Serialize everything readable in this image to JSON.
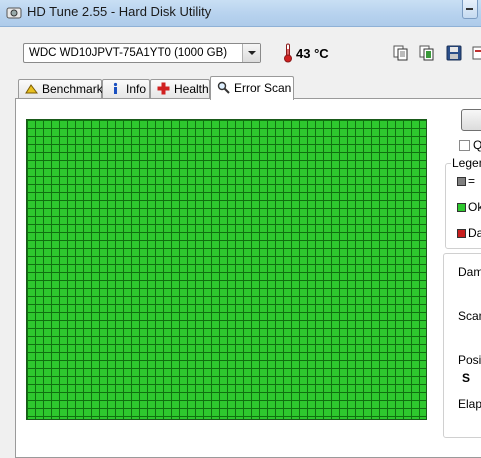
{
  "window": {
    "title": "HD Tune 2.55 - Hard Disk Utility"
  },
  "toolbar": {
    "drive": "WDC WD10JPVT-75A1YT0 (1000 GB)",
    "temperature": "43 °C",
    "icons": [
      "copy-icon",
      "copy-info-icon",
      "save-icon",
      "options-icon"
    ]
  },
  "tabs": [
    {
      "label": "Benchmark",
      "icon": "benchmark-icon"
    },
    {
      "label": "Info",
      "icon": "info-icon"
    },
    {
      "label": "Health",
      "icon": "health-cross-icon"
    },
    {
      "label": "Error Scan",
      "icon": "magnifier-icon",
      "active": true
    }
  ],
  "scan": {
    "block_status": "all ok",
    "colors": {
      "ok": "#2ec82e",
      "grid": "#107010"
    }
  },
  "side": {
    "quick_label": "Q",
    "legend": {
      "title": "Legen",
      "items": [
        {
          "label": "= ",
          "color": "#808080"
        },
        {
          "label": "Ok",
          "color": "#2ec82e"
        },
        {
          "label": "Da",
          "color": "#c81e1e"
        }
      ]
    },
    "stats": {
      "damaged_label": "Dama",
      "scan_label": "Scan",
      "position_label": "Posit",
      "position_value": "S",
      "elapsed_label": "Elaps"
    }
  }
}
